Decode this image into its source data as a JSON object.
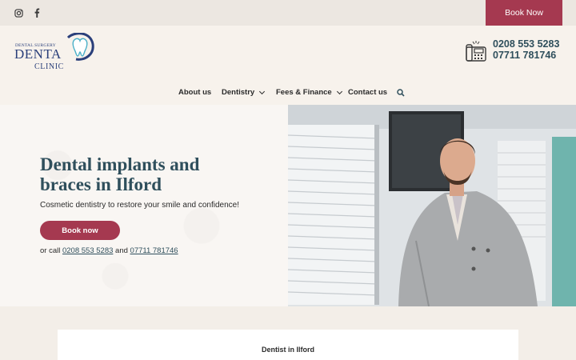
{
  "topbar": {
    "book_label": "Book Now",
    "social": [
      {
        "icon": "instagram-icon"
      },
      {
        "icon": "facebook-icon"
      }
    ]
  },
  "logo": {
    "line1": "DENTAL SURGERY",
    "line2": "DENTA",
    "line3": "CLINIC"
  },
  "contact": {
    "phone1": "0208 553 5283",
    "phone2": "07711 781746",
    "icon": "fax-phone-icon"
  },
  "nav": {
    "items": [
      {
        "label": "About us",
        "has_dropdown": false
      },
      {
        "label": "Dentistry",
        "has_dropdown": true
      },
      {
        "label": "Fees & Finance",
        "has_dropdown": true
      },
      {
        "label": "Contact us",
        "has_dropdown": false
      }
    ],
    "search_icon": "search-icon"
  },
  "hero": {
    "title_line1": "Dental implants and",
    "title_line2": "braces in Ilford",
    "subtitle": "Cosmetic dentistry to restore your smile and confidence!",
    "button_label": "Book now",
    "call_prefix": "or call",
    "call_phone1": "0208 553 5283",
    "call_and": "and",
    "call_phone2": "07711 781746"
  },
  "section": {
    "title": "Dentist in Ilford"
  },
  "colors": {
    "accent": "#a53950",
    "heading": "#2f4f5c",
    "background": "#f6f1ec"
  }
}
